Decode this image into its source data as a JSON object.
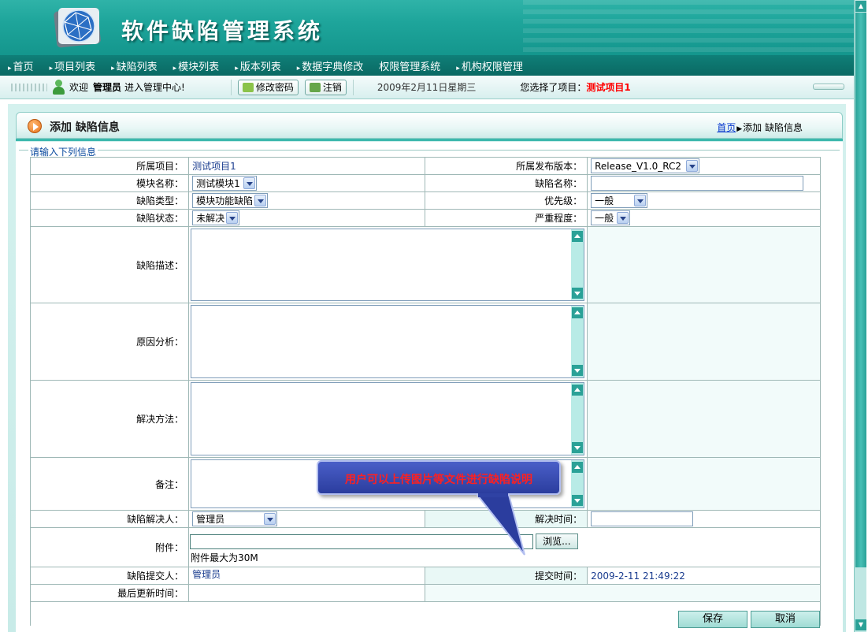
{
  "app": {
    "title": "软件缺陷管理系统"
  },
  "nav": {
    "items": [
      "首页",
      "项目列表",
      "缺陷列表",
      "模块列表",
      "版本列表",
      "数据字典修改",
      "权限管理系统",
      "机构权限管理"
    ]
  },
  "status": {
    "welcome_prefix": "欢迎",
    "user": "管理员",
    "welcome_suffix": "进入管理中心!",
    "change_password": "修改密码",
    "logout": "注销",
    "date": "2009年2月11日星期三",
    "project_label": "您选择了项目：",
    "project_value": "测试项目1"
  },
  "panel": {
    "title": "添加 缺陷信息",
    "breadcrumb_home": "首页",
    "breadcrumb_current": "添加 缺陷信息",
    "legend": "请输入下列信息"
  },
  "form": {
    "project_label": "所属项目：",
    "project_value": "测试项目1",
    "release_label": "所属发布版本：",
    "release_value": "Release_V1.0_RC2",
    "module_label": "模块名称：",
    "module_value": "测试模块1",
    "defect_name_label": "缺陷名称：",
    "defect_name_value": "",
    "type_label": "缺陷类型：",
    "type_value": "模块功能缺陷",
    "priority_label": "优先级：",
    "priority_value": "一般",
    "state_label": "缺陷状态：",
    "state_value": "未解决",
    "severity_label": "严重程度：",
    "severity_value": "一般",
    "description_label": "缺陷描述：",
    "cause_label": "原因分析：",
    "solution_label": "解决方法：",
    "remark_label": "备注：",
    "resolver_label": "缺陷解决人：",
    "resolver_value": "管理员",
    "resolve_time_label": "解决时间：",
    "resolve_time_value": "",
    "attachment_label": "附件：",
    "browse": "浏览...",
    "attachment_hint": "附件最大为30M",
    "submitter_label": "缺陷提交人：",
    "submitter_value": "管理员",
    "submit_time_label": "提交时间：",
    "submit_time_value": "2009-2-11 21:49:22",
    "last_update_label": "最后更新时间："
  },
  "buttons": {
    "save": "保存",
    "cancel": "取消"
  },
  "callout": {
    "text": "用户可以上传图片等文件进行缺陷说明"
  },
  "colors": {
    "header": "#1ea59b",
    "nav": "#0f7f78",
    "accent_red": "#ff0000",
    "link": "#0033cc"
  }
}
